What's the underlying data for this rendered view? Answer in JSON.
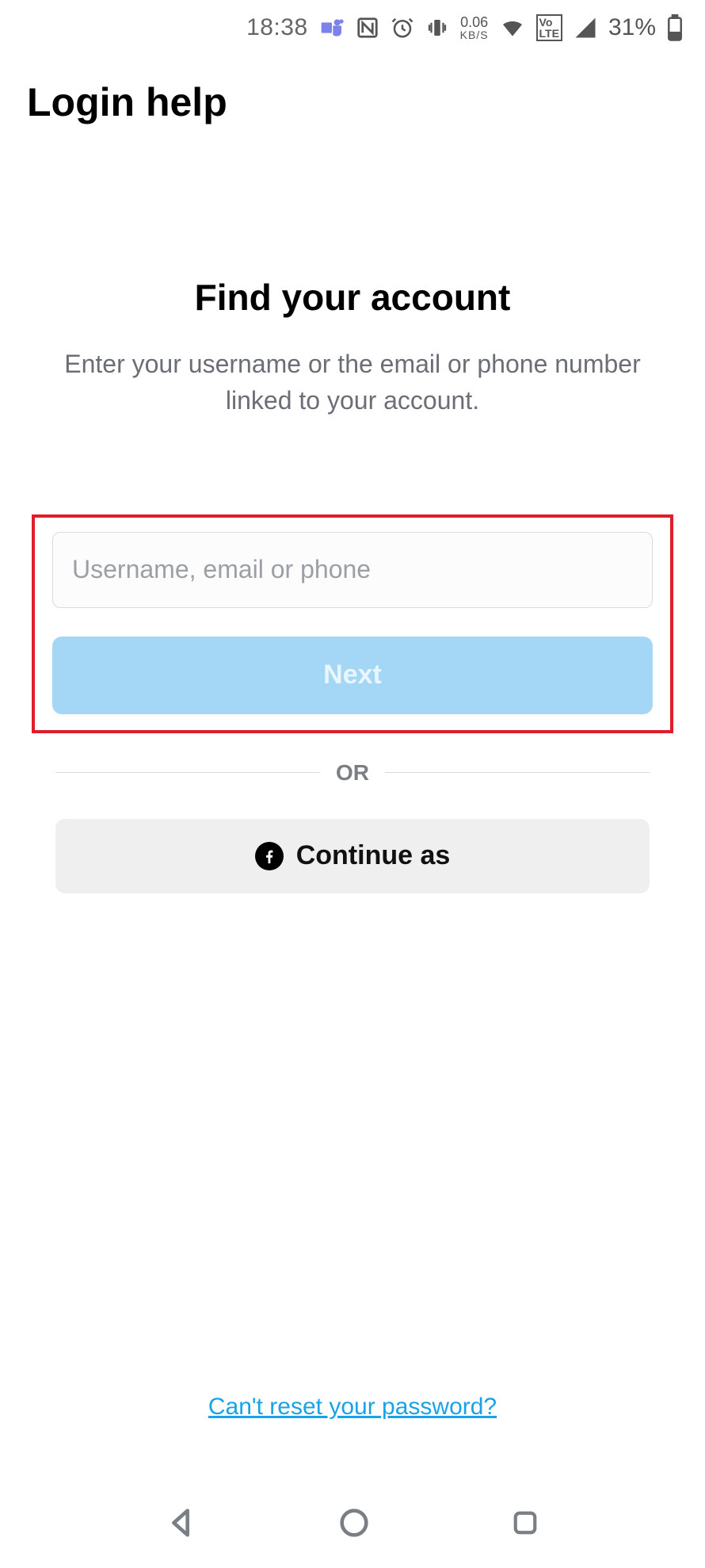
{
  "status_bar": {
    "time": "18:38",
    "net_speed_value": "0.06",
    "net_speed_unit": "KB/S",
    "volte": "Vo LTE",
    "battery_pct": "31%"
  },
  "header": {
    "title": "Login help"
  },
  "main": {
    "heading": "Find your account",
    "subhead": "Enter your username or the email or phone number linked to your account.",
    "input_placeholder": "Username, email or phone",
    "next_label": "Next",
    "divider_label": "OR",
    "fb_label": "Continue as",
    "reset_link": "Can't reset your password?"
  }
}
